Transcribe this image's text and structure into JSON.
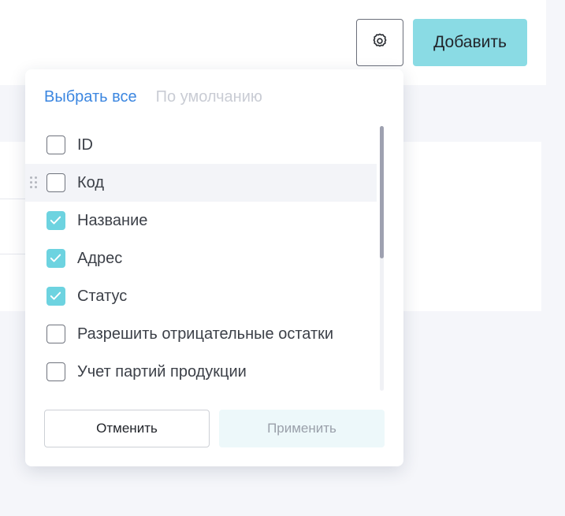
{
  "header": {
    "add_label": "Добавить",
    "settings_icon": "gear-icon"
  },
  "column_picker": {
    "select_all_label": "Выбрать все",
    "default_label": "По умолчанию",
    "items": [
      {
        "label": "ID",
        "checked": false
      },
      {
        "label": "Код",
        "checked": false,
        "hovered": true
      },
      {
        "label": "Название",
        "checked": true
      },
      {
        "label": "Адрес",
        "checked": true
      },
      {
        "label": "Статус",
        "checked": true
      },
      {
        "label": "Разрешить отрицательные остатки",
        "checked": false
      },
      {
        "label": "Учет партий продукции",
        "checked": false
      }
    ],
    "cancel_label": "Отменить",
    "apply_label": "Применить"
  },
  "colors": {
    "accent": "#8adbe4",
    "checkbox_checked": "#6dd3e0",
    "link": "#3b86e0",
    "link_disabled": "#c9ccd4"
  }
}
